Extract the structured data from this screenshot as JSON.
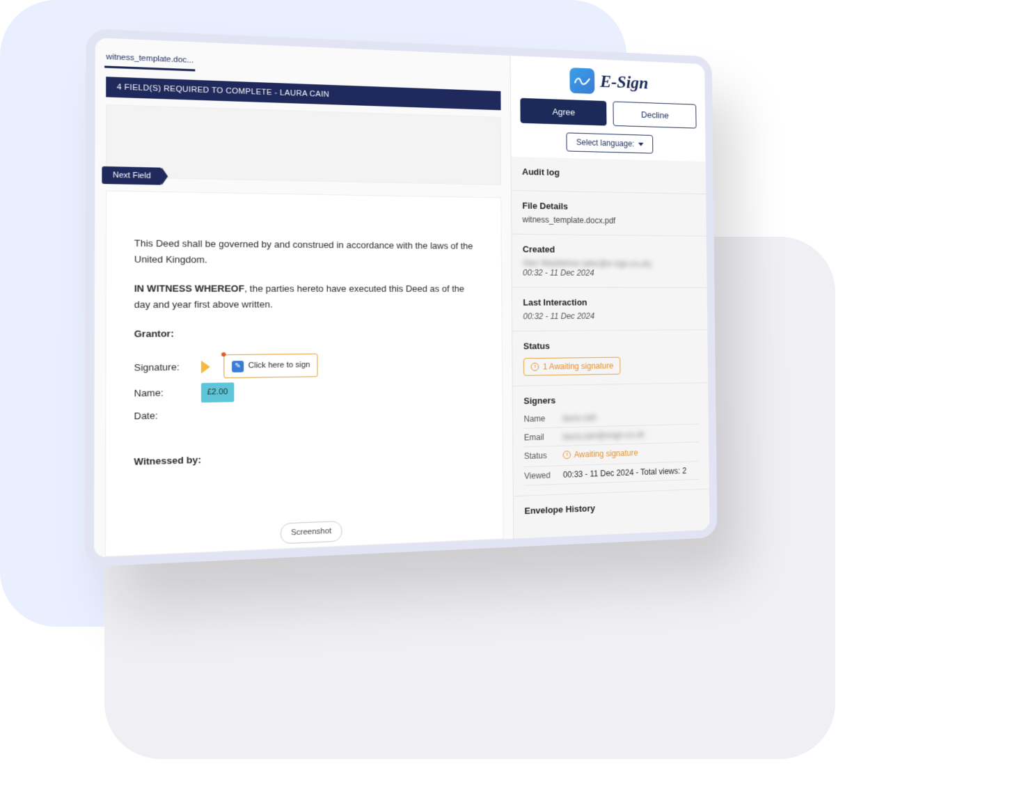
{
  "tabs": {
    "document": "witness_template.doc..."
  },
  "banner": "4 FIELD(S) REQUIRED TO COMPLETE - LAURA CAIN",
  "next_field": "Next Field",
  "document": {
    "para1": "This Deed shall be governed by and construed in accordance with the laws of the United Kingdom.",
    "witness_lead": "IN WITNESS WHEREOF",
    "witness_rest": ", the parties hereto have executed this Deed as of the day and year first above written.",
    "grantor_heading": "Grantor:",
    "signature_label": "Signature:",
    "sign_button": "Click here to sign",
    "name_label": "Name:",
    "name_chip": "£2.00",
    "date_label": "Date:",
    "witnessed_by": "Witnessed by:",
    "screenshot": "Screenshot"
  },
  "brand": "E-Sign",
  "actions": {
    "agree": "Agree",
    "decline": "Decline"
  },
  "language_select": "Select language:",
  "sidebar": {
    "audit_log": "Audit log",
    "file_details_label": "File Details",
    "file_details_value": "witness_template.docx.pdf",
    "created_label": "Created",
    "created_by": "Alex Waddelove (alex@e-sign.co.uk)",
    "created_ts": "00:32 - 11 Dec 2024",
    "last_interaction_label": "Last Interaction",
    "last_interaction_ts": "00:32 - 11 Dec 2024",
    "status_label": "Status",
    "status_pill": "1 Awaiting signature",
    "signers_label": "Signers",
    "signer_name_k": "Name",
    "signer_name_v": "laura cain",
    "signer_email_k": "Email",
    "signer_email_v": "laura.cain@esign.co.uk",
    "signer_status_k": "Status",
    "signer_status_v": "Awaiting signature",
    "signer_viewed_k": "Viewed",
    "signer_viewed_v": "00:33 - 11 Dec 2024 - Total views: 2",
    "envelope_history": "Envelope History"
  }
}
